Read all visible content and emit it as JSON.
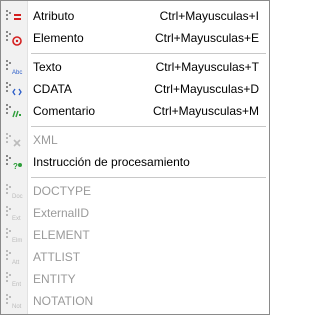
{
  "menu": {
    "items": [
      {
        "label": "Atributo",
        "shortcut": "Ctrl+Mayusculas+I",
        "icon": "attribute-icon",
        "enabled": true
      },
      {
        "label": "Elemento",
        "shortcut": "Ctrl+Mayusculas+E",
        "icon": "element-icon",
        "enabled": true
      },
      {
        "label": "Texto",
        "shortcut": "Ctrl+Mayusculas+T",
        "icon": "text-node-icon",
        "enabled": true
      },
      {
        "label": "CDATA",
        "shortcut": "Ctrl+Mayusculas+D",
        "icon": "cdata-icon",
        "enabled": true
      },
      {
        "label": "Comentario",
        "shortcut": "Ctrl+Mayusculas+M",
        "icon": "comment-icon",
        "enabled": true
      },
      {
        "label": "XML",
        "shortcut": "",
        "icon": "xml-declaration-icon",
        "enabled": false
      },
      {
        "label": "Instrucción de procesamiento",
        "shortcut": "",
        "icon": "processing-instruction-icon",
        "enabled": true
      },
      {
        "label": "DOCTYPE",
        "shortcut": "",
        "icon": "doctype-icon",
        "enabled": false
      },
      {
        "label": "ExternalID",
        "shortcut": "",
        "icon": "external-id-icon",
        "enabled": false
      },
      {
        "label": "ELEMENT",
        "shortcut": "",
        "icon": "dtd-element-icon",
        "enabled": false
      },
      {
        "label": "ATTLIST",
        "shortcut": "",
        "icon": "attlist-icon",
        "enabled": false
      },
      {
        "label": "ENTITY",
        "shortcut": "",
        "icon": "entity-icon",
        "enabled": false
      },
      {
        "label": "NOTATION",
        "shortcut": "",
        "icon": "notation-icon",
        "enabled": false
      }
    ]
  },
  "colors": {
    "text": "#000000",
    "disabled_text": "#9a9a9a",
    "gutter": "#f1f1f1",
    "icon_red": "#d41f1f",
    "icon_green": "#2e9e3a",
    "icon_blue": "#2a5cc8"
  }
}
